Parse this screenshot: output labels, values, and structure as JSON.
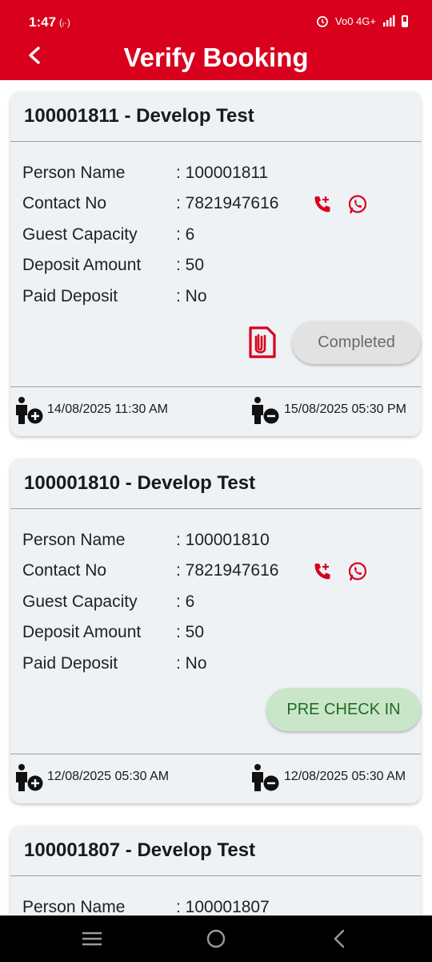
{
  "status_bar": {
    "time": "1:47",
    "left_indicator": "(ᵢ·)",
    "right_indicators": "Vo0 4G+"
  },
  "app_bar": {
    "title": "Verify Booking",
    "back_icon": "arrow-back-icon"
  },
  "colors": {
    "primary": "#d8001d",
    "card_bg": "#eef2f5",
    "completed_bg": "#e2e2e2",
    "precheck_bg": "#c9e7c8",
    "precheck_text": "#1f6b25"
  },
  "labels": {
    "person_name": "Person Name",
    "contact_no": "Contact No",
    "guest_capacity": "Guest Capacity",
    "deposit_amount": "Deposit Amount",
    "paid_deposit": "Paid Deposit"
  },
  "bookings": [
    {
      "title": "100001811 - Develop Test",
      "person_name": ": 100001811",
      "contact_no": ": 7821947616",
      "guest_capacity": ": 6",
      "deposit_amount": ": 50",
      "paid_deposit": ": No",
      "status_button": "Completed",
      "has_attachment": true,
      "checkin": "14/08/2025 11:30 AM",
      "checkout": "15/08/2025 05:30 PM"
    },
    {
      "title": "100001810 - Develop Test",
      "person_name": ": 100001810",
      "contact_no": ": 7821947616",
      "guest_capacity": ": 6",
      "deposit_amount": ": 50",
      "paid_deposit": ": No",
      "status_button": "PRE CHECK IN",
      "has_attachment": false,
      "checkin": "12/08/2025 05:30 AM",
      "checkout": "12/08/2025 05:30 AM"
    },
    {
      "title": "100001807 - Develop Test",
      "person_name": ": 100001807"
    }
  ],
  "nav_bar": {
    "icons": [
      "recent-apps-icon",
      "home-icon",
      "back-nav-icon"
    ]
  }
}
